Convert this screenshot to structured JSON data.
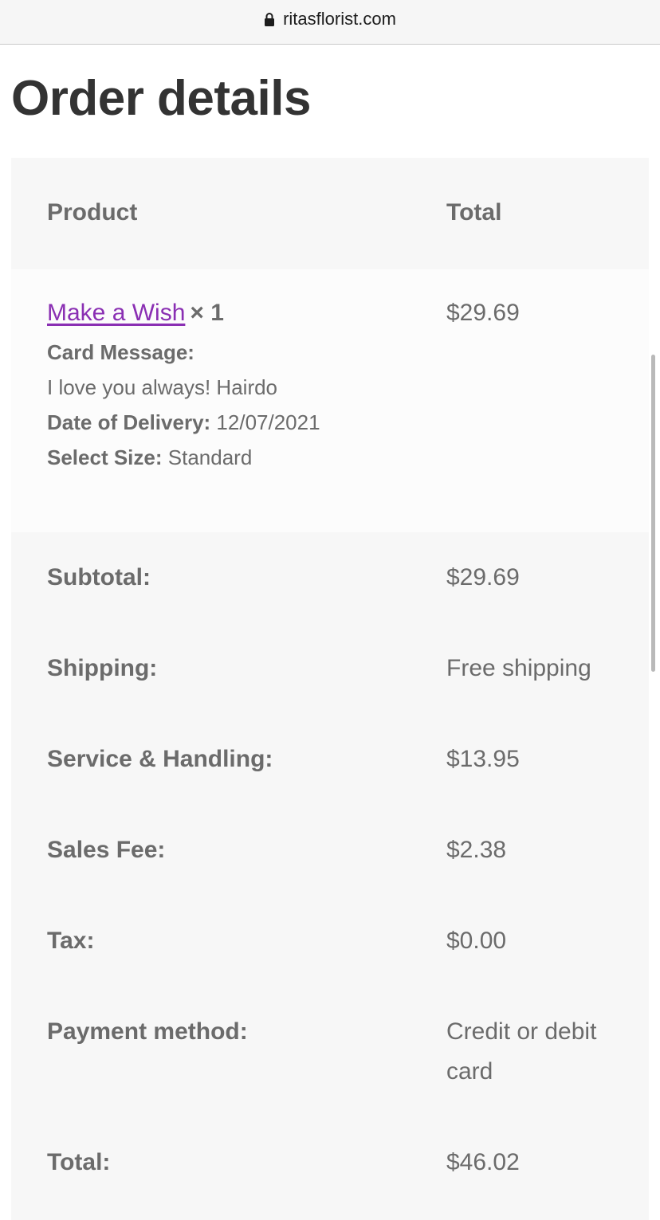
{
  "browser": {
    "url": "ritasflorist.com",
    "lock_icon": "lock-icon"
  },
  "page": {
    "title": "Order details"
  },
  "table": {
    "headers": {
      "product": "Product",
      "total": "Total"
    },
    "item": {
      "name": "Make a Wish",
      "quantity": "× 1",
      "price": "$29.69",
      "card_message_label": "Card Message:",
      "card_message": "I love you always! Hairdo",
      "date_label": "Date of Delivery:",
      "date_value": "12/07/2021",
      "size_label": "Select Size:",
      "size_value": "Standard"
    },
    "totals": [
      {
        "label": "Subtotal:",
        "value": "$29.69"
      },
      {
        "label": "Shipping:",
        "value": "Free shipping"
      },
      {
        "label": "Service & Handling:",
        "value": "$13.95"
      },
      {
        "label": "Sales Fee:",
        "value": "$2.38"
      },
      {
        "label": "Tax:",
        "value": "$0.00"
      },
      {
        "label": "Payment method:",
        "value": "Credit or debit card"
      },
      {
        "label": "Total:",
        "value": "$46.02"
      }
    ]
  },
  "colors": {
    "link": "#8a2fb3",
    "text": "#6b6b6b",
    "title": "#333333",
    "table_bg": "#f7f7f7"
  }
}
